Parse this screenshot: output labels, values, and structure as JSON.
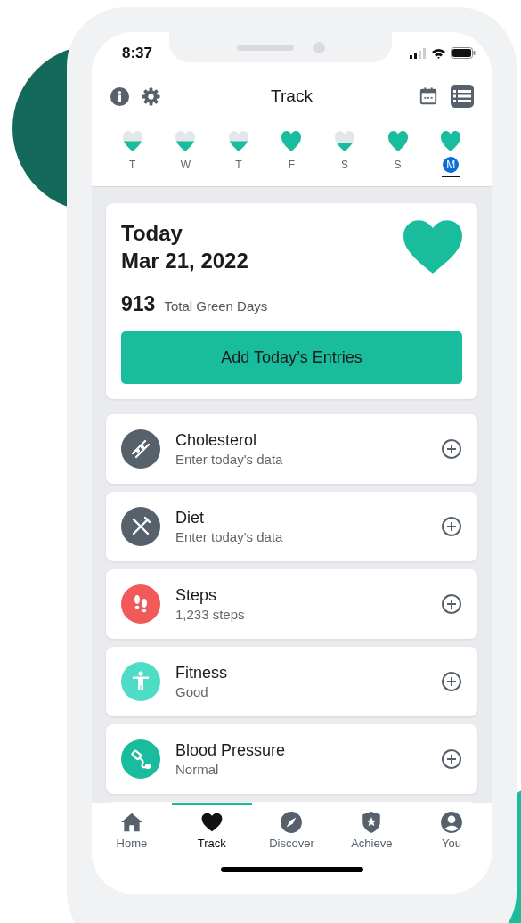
{
  "status_bar": {
    "time": "8:37"
  },
  "header": {
    "title": "Track",
    "view_buttons": [
      {
        "kind": "calendar",
        "selected": false
      },
      {
        "kind": "list",
        "selected": true
      }
    ]
  },
  "days": [
    {
      "label": "T",
      "level": 0.5,
      "selected": false
    },
    {
      "label": "W",
      "level": 0.5,
      "selected": false
    },
    {
      "label": "T",
      "level": 0.5,
      "selected": false
    },
    {
      "label": "F",
      "level": 1,
      "selected": false
    },
    {
      "label": "S",
      "level": 0.4,
      "selected": false
    },
    {
      "label": "S",
      "level": 1,
      "selected": false
    },
    {
      "label": "M",
      "level": 1,
      "selected": true
    }
  ],
  "today": {
    "title": "Today",
    "date": "Mar 21, 2022",
    "count": "913",
    "count_label": "Total Green Days",
    "button": "Add Today’s Entries"
  },
  "items": [
    {
      "kind": "cholesterol",
      "title": "Cholesterol",
      "subtitle": "Enter today's data",
      "color": "#56616c"
    },
    {
      "kind": "diet",
      "title": "Diet",
      "subtitle": "Enter today's data",
      "color": "#56616c"
    },
    {
      "kind": "steps",
      "title": "Steps",
      "subtitle": "1,233 steps",
      "color": "#f25a5a"
    },
    {
      "kind": "fitness",
      "title": "Fitness",
      "subtitle": "Good",
      "color": "#4fdcc6"
    },
    {
      "kind": "blood_pressure",
      "title": "Blood Pressure",
      "subtitle": "Normal",
      "color": "#19bc9c"
    }
  ],
  "tabs": [
    {
      "kind": "home",
      "label": "Home",
      "selected": false
    },
    {
      "kind": "track",
      "label": "Track",
      "selected": true
    },
    {
      "kind": "discover",
      "label": "Discover",
      "selected": false
    },
    {
      "kind": "achieve",
      "label": "Achieve",
      "selected": false
    },
    {
      "kind": "you",
      "label": "You",
      "selected": false
    }
  ]
}
